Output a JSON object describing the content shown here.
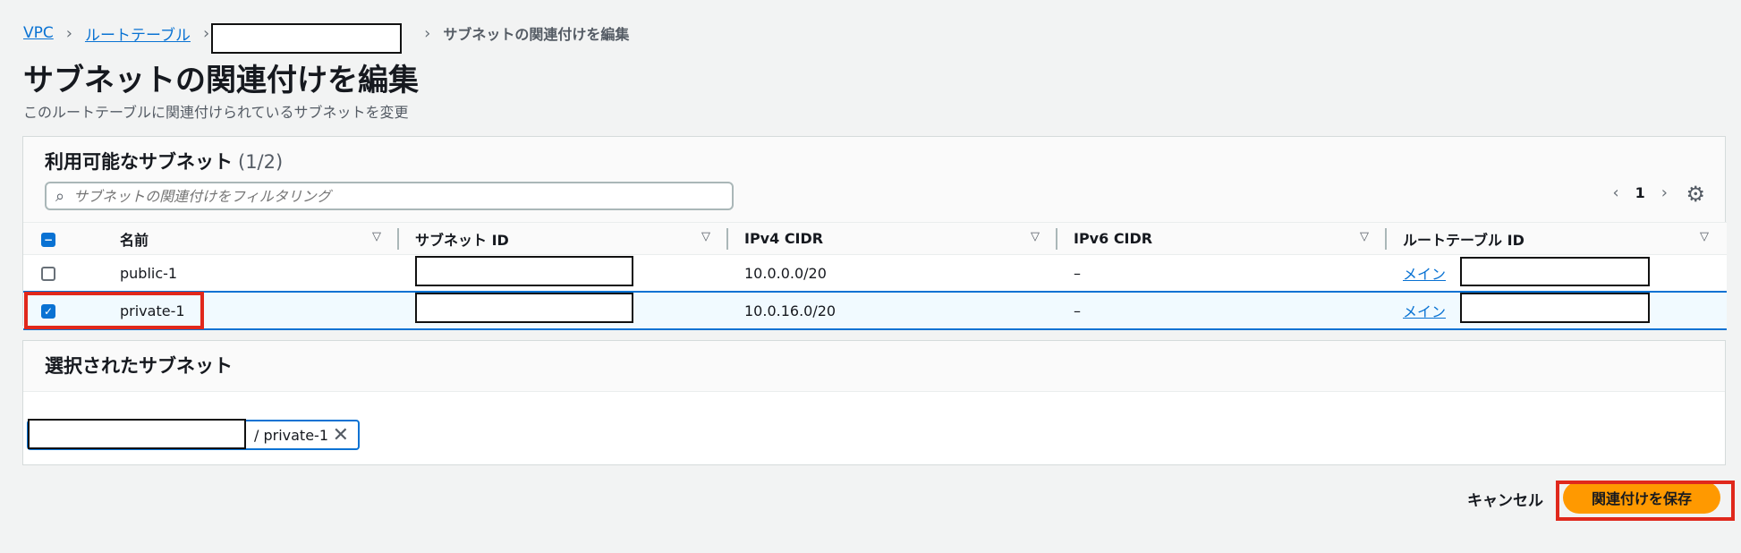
{
  "breadcrumb": {
    "items": [
      "VPC",
      "ルートテーブル"
    ],
    "current": "サブネットの関連付けを編集"
  },
  "page": {
    "title": "サブネットの関連付けを編集",
    "description": "このルートテーブルに関連付けられているサブネットを変更"
  },
  "available": {
    "title": "利用可能なサブネット",
    "count": "(1/2)",
    "search_placeholder": "サブネットの関連付けをフィルタリング",
    "page_number": "1",
    "columns": [
      "名前",
      "サブネット ID",
      "IPv4 CIDR",
      "IPv6 CIDR",
      "ルートテーブル ID"
    ],
    "rows": [
      {
        "name": "public-1",
        "ipv4": "10.0.0.0/20",
        "ipv6": "–",
        "route_table": "メイン",
        "checked": false
      },
      {
        "name": "private-1",
        "ipv4": "10.0.16.0/20",
        "ipv6": "–",
        "route_table": "メイン",
        "checked": true
      }
    ]
  },
  "selected": {
    "title": "選択されたサブネット",
    "token_text": "/ private-1"
  },
  "footer": {
    "cancel": "キャンセル",
    "save": "関連付けを保存"
  },
  "colors": {
    "accent": "#0972d3",
    "primary_button": "#ff9900",
    "highlight_box": "#e0281c"
  }
}
